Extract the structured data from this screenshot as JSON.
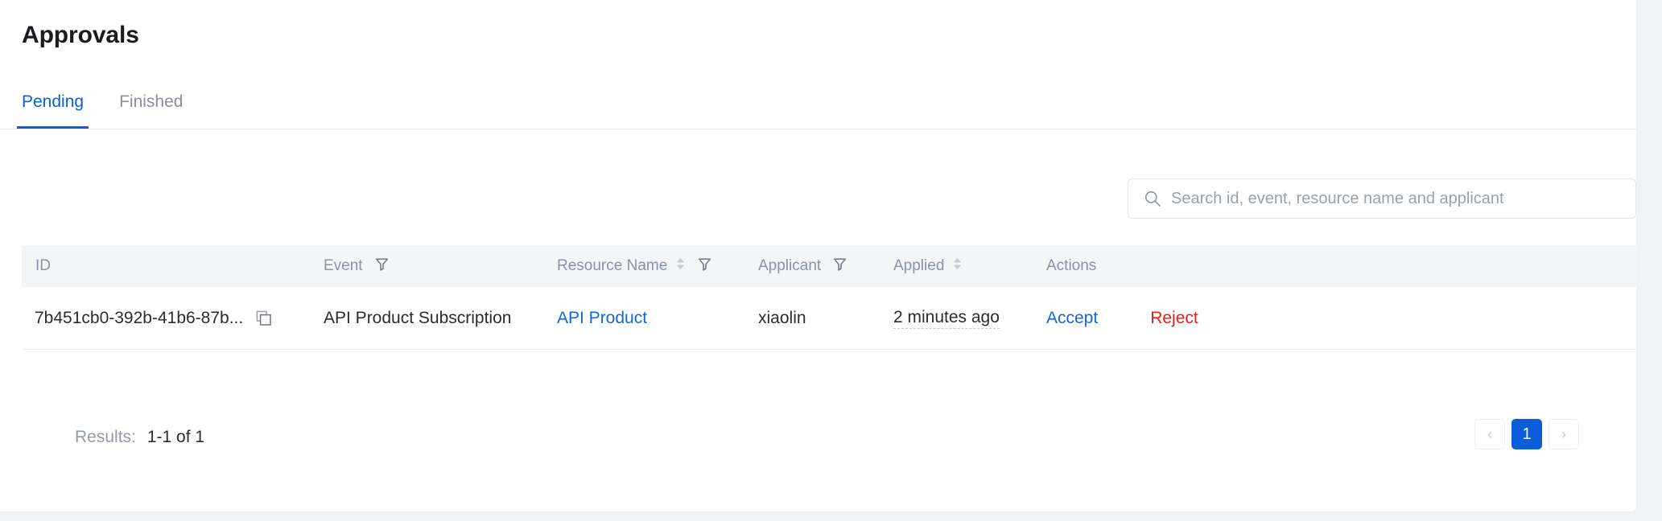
{
  "header": {
    "title": "Approvals"
  },
  "tabs": [
    {
      "label": "Pending",
      "active": true
    },
    {
      "label": "Finished",
      "active": false
    }
  ],
  "search": {
    "placeholder": "Search id, event, resource name and applicant",
    "value": "",
    "icon": "search-icon"
  },
  "table": {
    "columns": [
      {
        "label": "ID",
        "sortable": false,
        "filterable": false
      },
      {
        "label": "Event",
        "sortable": false,
        "filterable": true
      },
      {
        "label": "Resource Name",
        "sortable": true,
        "filterable": true
      },
      {
        "label": "Applicant",
        "sortable": false,
        "filterable": true
      },
      {
        "label": "Applied",
        "sortable": true,
        "filterable": false
      },
      {
        "label": "Actions",
        "sortable": false,
        "filterable": false
      }
    ],
    "rows": [
      {
        "id": "7b451cb0-392b-41b6-87b...",
        "copy_icon": "copy-icon",
        "event": "API Product Subscription",
        "resource_name": "API Product",
        "applicant": "xiaolin",
        "applied": "2 minutes ago",
        "accept_label": "Accept",
        "reject_label": "Reject"
      }
    ]
  },
  "footer": {
    "results_label": "Results:",
    "results_value": "1-1 of 1",
    "pagination": {
      "prev_glyph": "‹",
      "next_glyph": "›",
      "pages": [
        "1"
      ],
      "current_page": "1"
    }
  },
  "colors": {
    "accent_blue": "#0b5ed7",
    "link_blue": "#1167d8",
    "reject_red": "#f01818",
    "header_bg": "#f3f5f9",
    "page_bg": "#f0f2f5",
    "muted_text": "#8a92a6"
  }
}
